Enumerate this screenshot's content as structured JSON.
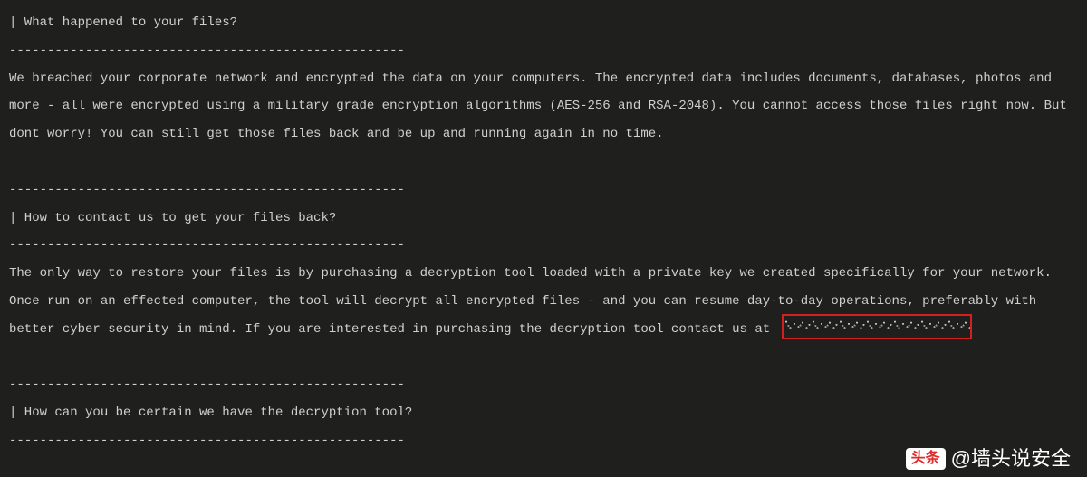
{
  "note": {
    "separator": "----------------------------------------------------",
    "section1": {
      "heading": "| What happened to your files?",
      "body": "We breached your corporate network and encrypted the data on your computers. The encrypted data includes documents, databases, photos and more - all were encrypted using a military grade encryption algorithms (AES-256 and RSA-2048). You cannot access those files right now. But dont worry! You can still get those files back and be up and running again in no time."
    },
    "section2": {
      "heading": "| How to contact us to get your files back?",
      "body_prefix": "The only way to restore your files is by purchasing a decryption tool loaded with a private key we created specifically for your network. Once run on an effected computer, the tool will decrypt all encrypted files - and you can resume day-to-day operations, preferably with better cyber security in mind. If you are interested in purchasing the decryption tool contact us at"
    },
    "section3": {
      "heading": "| How can you be certain we have the decryption tool?"
    }
  },
  "watermark": {
    "badge": "头条",
    "handle": "@墙头说安全"
  }
}
